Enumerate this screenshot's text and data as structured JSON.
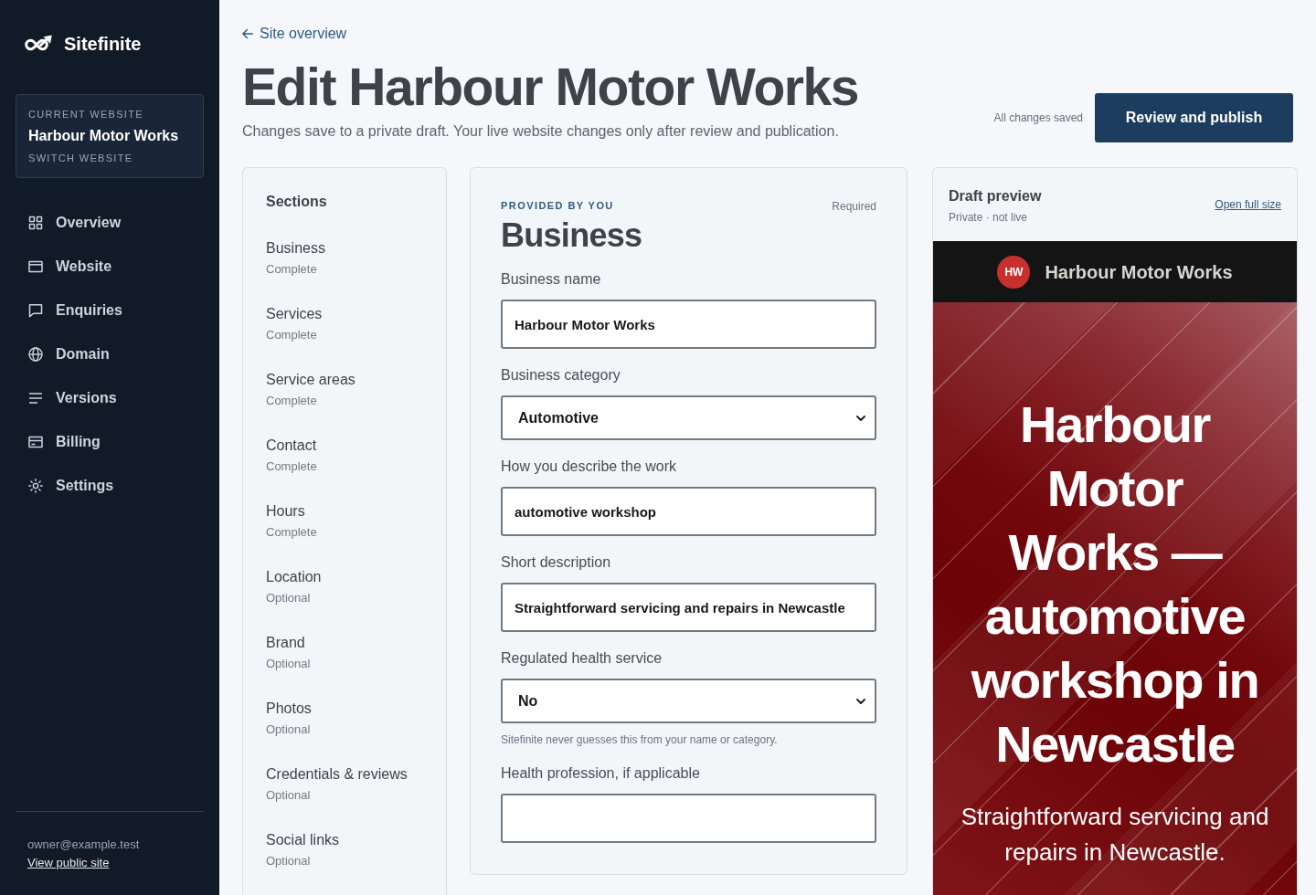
{
  "sidebar": {
    "brand": "Sitefinite",
    "current_website": {
      "caption": "CURRENT WEBSITE",
      "name": "Harbour Motor Works",
      "switch_label": "SWITCH WEBSITE"
    },
    "nav": [
      "Overview",
      "Website",
      "Enquiries",
      "Domain",
      "Versions",
      "Billing",
      "Settings"
    ],
    "account": {
      "email": "owner@example.test",
      "link": "View public site"
    }
  },
  "header": {
    "back_link": "Site overview",
    "title": "Edit Harbour Motor Works",
    "subtitle": "Changes save to a private draft. Your live website changes only after review and publication.",
    "save_status": "All changes saved",
    "primary_button": "Review and publish"
  },
  "sections": {
    "title": "Sections",
    "items": [
      {
        "name": "Business",
        "status": "Complete"
      },
      {
        "name": "Services",
        "status": "Complete"
      },
      {
        "name": "Service areas",
        "status": "Complete"
      },
      {
        "name": "Contact",
        "status": "Complete"
      },
      {
        "name": "Hours",
        "status": "Complete"
      },
      {
        "name": "Location",
        "status": "Optional"
      },
      {
        "name": "Brand",
        "status": "Optional"
      },
      {
        "name": "Photos",
        "status": "Optional"
      },
      {
        "name": "Credentials & reviews",
        "status": "Optional"
      },
      {
        "name": "Social links",
        "status": "Optional"
      }
    ]
  },
  "form": {
    "eyebrow": "PROVIDED BY YOU",
    "requirement": "Required",
    "title": "Business",
    "fields": [
      {
        "label": "Business name",
        "kind": "text",
        "value": "Harbour Motor Works"
      },
      {
        "label": "Business category",
        "kind": "select",
        "value": "Automotive"
      },
      {
        "label": "How you describe the work",
        "kind": "text",
        "value": "automotive workshop"
      },
      {
        "label": "Short description",
        "kind": "text",
        "value": "Straightforward servicing and repairs in Newcastle"
      },
      {
        "label": "Regulated health service",
        "kind": "select",
        "value": "No",
        "help": "Sitefinite never guesses this from your name or category."
      },
      {
        "label": "Health profession, if applicable",
        "kind": "text"
      }
    ]
  },
  "preview": {
    "title": "Draft preview",
    "subtitle": "Private · not live",
    "open_link": "Open full size",
    "site": {
      "monogram": "HW",
      "name": "Harbour Motor Works",
      "headline": "Harbour Motor Works — automotive workshop in Newcastle",
      "tagline": "Straightforward servicing and repairs in Newcastle."
    }
  }
}
